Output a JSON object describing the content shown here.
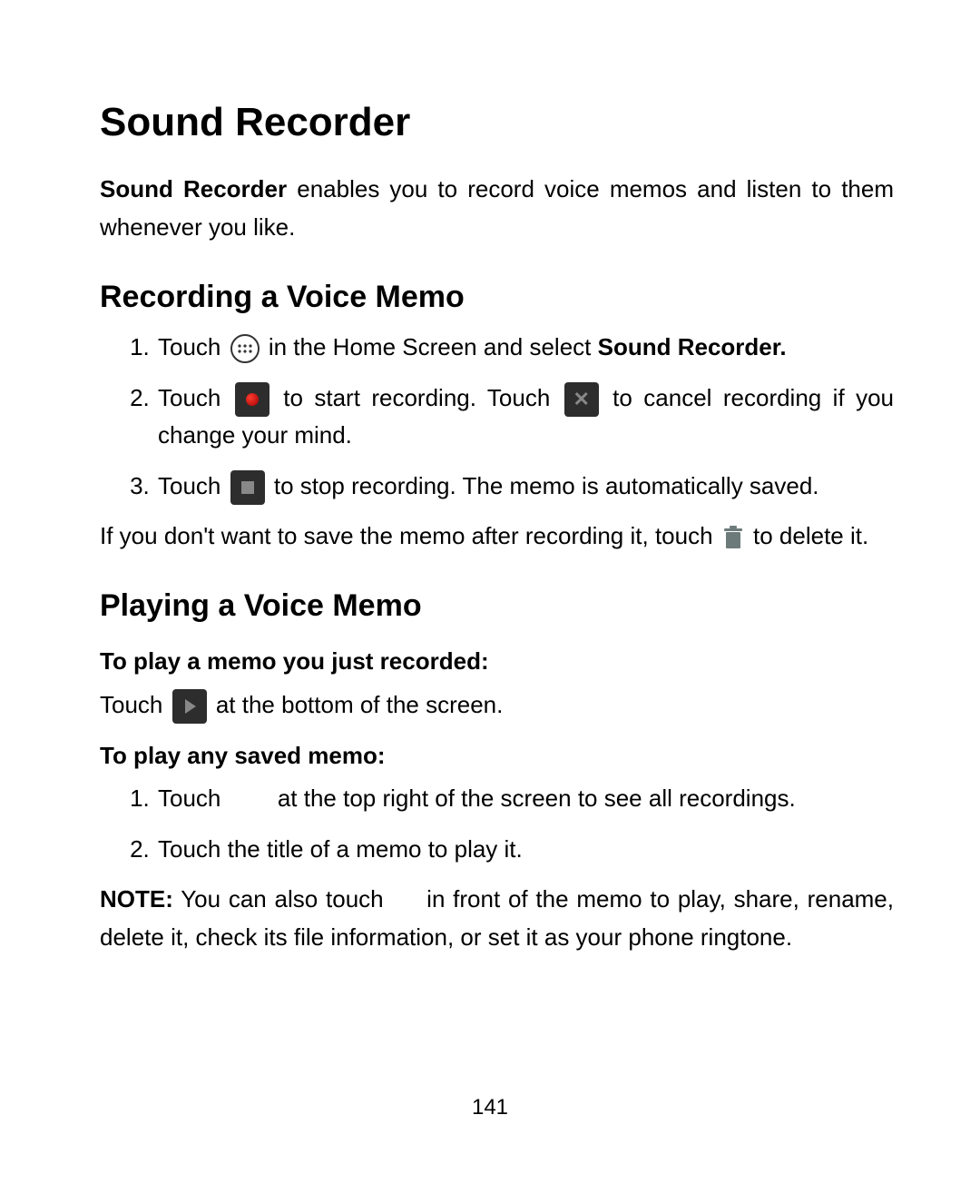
{
  "title": "Sound Recorder",
  "intro_bold": "Sound Recorder",
  "intro_rest": " enables you to record voice memos and listen to them whenever you like.",
  "section1_title": "Recording a Voice Memo",
  "rec_steps": {
    "s1_a": "Touch ",
    "s1_b": " in the Home Screen and select ",
    "s1_c": "Sound Recorder.",
    "s2_a": "Touch ",
    "s2_b": " to start recording. Touch ",
    "s2_c": " to cancel recording if you change your mind.",
    "s3_a": "Touch ",
    "s3_b": " to stop recording. The memo is automatically saved."
  },
  "delete_a": "If you don't want to save the memo after recording it, touch ",
  "delete_b": " to delete it.",
  "section2_title": "Playing a Voice Memo",
  "play_sub1": "To play a memo you just recorded:",
  "play_line_a": "Touch ",
  "play_line_b": " at the bottom of the screen.",
  "play_sub2": "To play any saved memo:",
  "saved_steps": {
    "s1_a": "Touch ",
    "s1_b": " at the top right of the screen to see all recordings.",
    "s2": "Touch the title of a memo to play it."
  },
  "note_label": "NOTE:",
  "note_a": " You can also touch ",
  "note_b": " in front of the memo to play, share, rename, delete it, check its file information, or set it as your phone ringtone.",
  "page_number": "141"
}
